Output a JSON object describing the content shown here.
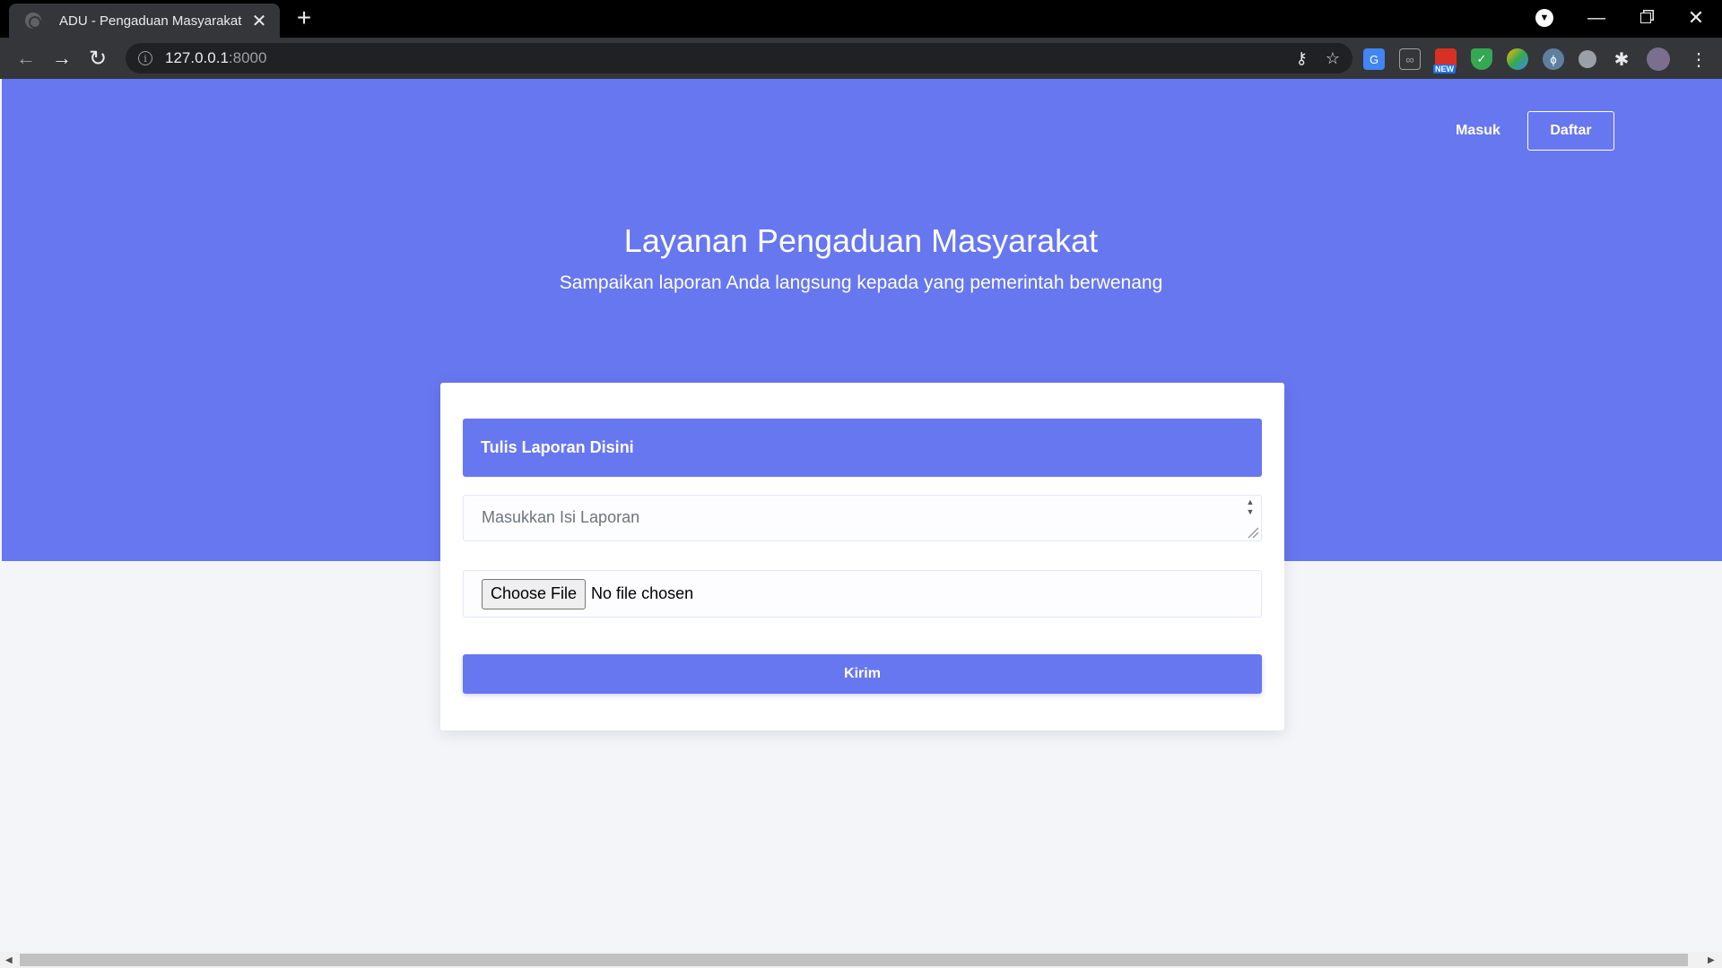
{
  "browser": {
    "tab_title": "ADU - Pengaduan Masyarakat",
    "tab_close": "✕",
    "new_tab": "+",
    "url_host": "127.0.0.1",
    "url_port": ":8000",
    "ext_new_badge": "NEW"
  },
  "nav": {
    "login": "Masuk",
    "register": "Daftar"
  },
  "hero": {
    "title": "Layanan Pengaduan Masyarakat",
    "subtitle": "Sampaikan laporan Anda langsung kepada yang pemerintah berwenang"
  },
  "form": {
    "header": "Tulis Laporan Disini",
    "report_placeholder": "Masukkan Isi Laporan",
    "file_button": "Choose File",
    "file_status": "No file chosen",
    "submit": "Kirim"
  },
  "colors": {
    "primary": "#6777ef",
    "page_bg": "#f4f5f8"
  }
}
